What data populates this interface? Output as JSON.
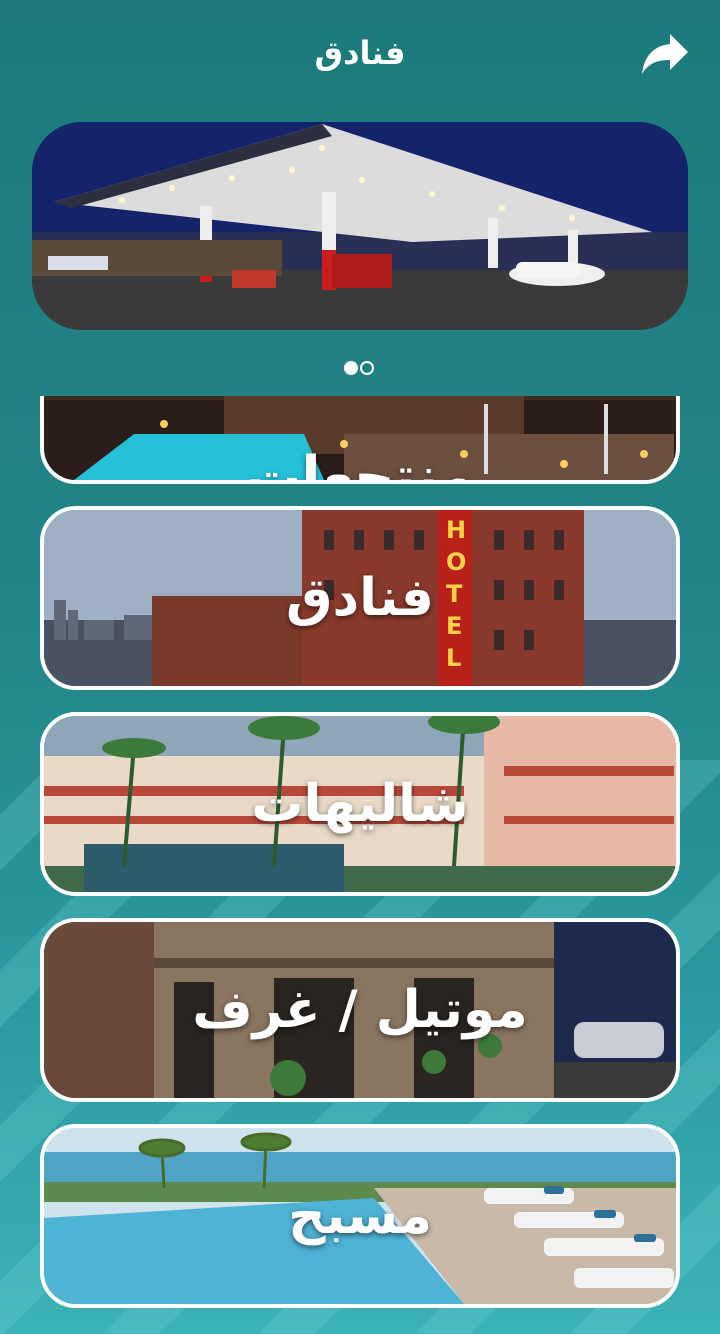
{
  "header": {
    "title": "فنادق",
    "share_icon": "share-arrow-icon"
  },
  "banner": {
    "alt": "gas-station-image"
  },
  "carousel": {
    "count": 2,
    "active_index": 0
  },
  "categories": [
    {
      "label": "منتجعات",
      "image": "resort-pool-night"
    },
    {
      "label": "فنادق",
      "image": "hotel-brick-building"
    },
    {
      "label": "شاليهات",
      "image": "chalets-palm-trees"
    },
    {
      "label": "موتيل / غرف",
      "image": "motel-rooms-night"
    },
    {
      "label": "مسبح",
      "image": "pool-sunbeds"
    }
  ],
  "colors": {
    "background": "#1f7e7e",
    "card_border": "#ffffff",
    "text": "#ffffff"
  }
}
